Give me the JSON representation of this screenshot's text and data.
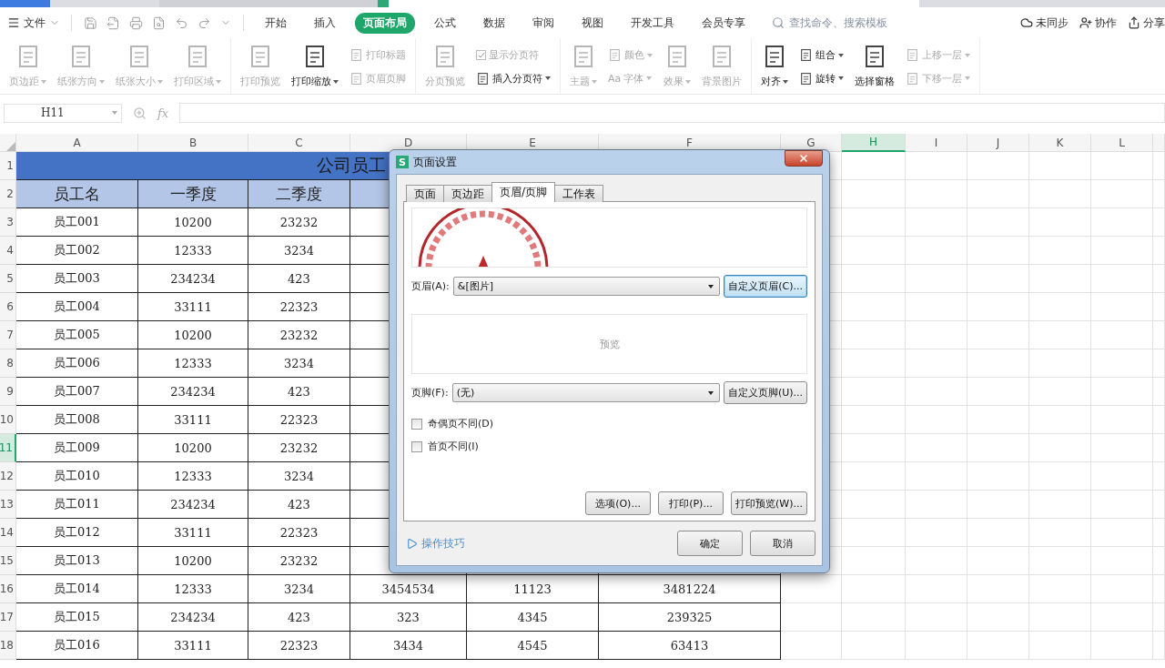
{
  "menu": {
    "file": "文件",
    "tabs": [
      {
        "label": "开始",
        "selected": false
      },
      {
        "label": "插入",
        "selected": false
      },
      {
        "label": "页面布局",
        "selected": true
      },
      {
        "label": "公式",
        "selected": false
      },
      {
        "label": "数据",
        "selected": false
      },
      {
        "label": "审阅",
        "selected": false
      },
      {
        "label": "视图",
        "selected": false
      },
      {
        "label": "开发工具",
        "selected": false
      },
      {
        "label": "会员专享",
        "selected": false
      }
    ],
    "search": {
      "placeholder": "查找命令、搜索模板"
    },
    "actions": [
      "未同步",
      "协作",
      "分享"
    ]
  },
  "ribbon": {
    "groups": [
      [
        {
          "kind": "large",
          "label": "页边距",
          "dropdown": true,
          "disabled": true
        },
        {
          "kind": "large",
          "label": "纸张方向",
          "dropdown": true,
          "disabled": true
        },
        {
          "kind": "large",
          "label": "纸张大小",
          "dropdown": true,
          "disabled": true
        },
        {
          "kind": "large",
          "label": "打印区域",
          "dropdown": true,
          "disabled": true
        }
      ],
      [
        {
          "kind": "large",
          "label": "打印预览",
          "dropdown": false,
          "disabled": true
        },
        {
          "kind": "large",
          "label": "打印缩放",
          "dropdown": true,
          "disabled": false
        },
        {
          "kind": "stack",
          "items": [
            {
              "kind": "small",
              "label": "打印标题",
              "dropdown": false,
              "disabled": true
            },
            {
              "kind": "small",
              "label": "页眉页脚",
              "dropdown": false,
              "disabled": true
            }
          ]
        }
      ],
      [
        {
          "kind": "large",
          "label": "分页预览",
          "dropdown": false,
          "disabled": true
        },
        {
          "kind": "stack",
          "items": [
            {
              "kind": "check",
              "label": "显示分页符",
              "checked": true,
              "disabled": true
            },
            {
              "kind": "small",
              "label": "插入分页符",
              "dropdown": true,
              "disabled": false
            }
          ]
        }
      ],
      [
        {
          "kind": "large",
          "label": "主题",
          "dropdown": true,
          "disabled": true
        },
        {
          "kind": "stack",
          "items": [
            {
              "kind": "small",
              "label": "颜色",
              "dropdown": true,
              "disabled": true
            },
            {
              "kind": "small",
              "label": "字体",
              "glyph": "Aa",
              "dropdown": true,
              "disabled": true
            }
          ]
        },
        {
          "kind": "large",
          "label": "效果",
          "dropdown": true,
          "disabled": true
        },
        {
          "kind": "large",
          "label": "背景图片",
          "dropdown": false,
          "disabled": true
        }
      ],
      [
        {
          "kind": "large",
          "label": "对齐",
          "dropdown": true,
          "disabled": false
        },
        {
          "kind": "stack",
          "items": [
            {
              "kind": "small",
              "label": "组合",
              "dropdown": true,
              "disabled": false
            },
            {
              "kind": "small",
              "label": "旋转",
              "dropdown": true,
              "disabled": false
            }
          ]
        },
        {
          "kind": "large",
          "label": "选择窗格",
          "dropdown": false,
          "disabled": false
        },
        {
          "kind": "stack",
          "items": [
            {
              "kind": "small",
              "label": "上移一层",
              "dropdown": true,
              "disabled": true
            },
            {
              "kind": "small",
              "label": "下移一层",
              "dropdown": true,
              "disabled": true
            }
          ]
        }
      ]
    ]
  },
  "formula_bar": {
    "cell": "H11",
    "fx": "fx"
  },
  "sheet": {
    "columns": [
      {
        "label": "A",
        "selected": false
      },
      {
        "label": "B",
        "selected": false
      },
      {
        "label": "C",
        "selected": false
      },
      {
        "label": "D",
        "selected": false
      },
      {
        "label": "E",
        "selected": false
      },
      {
        "label": "F",
        "selected": false
      },
      {
        "label": "G",
        "selected": false
      },
      {
        "label": "H",
        "selected": true
      },
      {
        "label": "I",
        "selected": false
      },
      {
        "label": "J",
        "selected": false
      },
      {
        "label": "K",
        "selected": false
      },
      {
        "label": "L",
        "selected": false
      }
    ],
    "rows": [
      {
        "num": "1",
        "kind": "title",
        "selected": false,
        "cells": [
          "公司员工"
        ]
      },
      {
        "num": "2",
        "kind": "header",
        "selected": false,
        "cells": [
          "员工名",
          "一季度",
          "二季度"
        ]
      },
      {
        "num": "3",
        "kind": "data",
        "selected": false,
        "cells": [
          "员工001",
          "10200",
          "23232"
        ]
      },
      {
        "num": "4",
        "kind": "data",
        "selected": false,
        "cells": [
          "员工002",
          "12333",
          "3234"
        ]
      },
      {
        "num": "5",
        "kind": "data",
        "selected": false,
        "cells": [
          "员工003",
          "234234",
          "423"
        ]
      },
      {
        "num": "6",
        "kind": "data",
        "selected": false,
        "cells": [
          "员工004",
          "33111",
          "22323"
        ]
      },
      {
        "num": "7",
        "kind": "data",
        "selected": false,
        "cells": [
          "员工005",
          "10200",
          "23232"
        ]
      },
      {
        "num": "8",
        "kind": "data",
        "selected": false,
        "cells": [
          "员工006",
          "12333",
          "3234"
        ]
      },
      {
        "num": "9",
        "kind": "data",
        "selected": false,
        "cells": [
          "员工007",
          "234234",
          "423"
        ]
      },
      {
        "num": "10",
        "kind": "data",
        "selected": false,
        "cells": [
          "员工008",
          "33111",
          "22323"
        ]
      },
      {
        "num": "11",
        "kind": "data",
        "selected": true,
        "cells": [
          "员工009",
          "10200",
          "23232"
        ]
      },
      {
        "num": "12",
        "kind": "data",
        "selected": false,
        "cells": [
          "员工010",
          "12333",
          "3234"
        ]
      },
      {
        "num": "13",
        "kind": "data",
        "selected": false,
        "cells": [
          "员工011",
          "234234",
          "423"
        ]
      },
      {
        "num": "14",
        "kind": "data",
        "selected": false,
        "cells": [
          "员工012",
          "33111",
          "22323"
        ]
      },
      {
        "num": "15",
        "kind": "data",
        "selected": false,
        "cells": [
          "员工013",
          "10200",
          "23232"
        ]
      },
      {
        "num": "16",
        "kind": "data",
        "selected": false,
        "cells": [
          "员工014",
          "12333",
          "3234",
          "3454534",
          "11123",
          "3481224"
        ]
      },
      {
        "num": "17",
        "kind": "data",
        "selected": false,
        "cells": [
          "员工015",
          "234234",
          "423",
          "323",
          "4345",
          "239325"
        ]
      },
      {
        "num": "18",
        "kind": "data",
        "selected": false,
        "cells": [
          "员工016",
          "33111",
          "22323",
          "3434",
          "4545",
          "63413"
        ]
      }
    ]
  },
  "dialog": {
    "app_badge": "S",
    "title": "页面设置",
    "tabs": [
      {
        "label": "页面",
        "selected": false
      },
      {
        "label": "页边距",
        "selected": false
      },
      {
        "label": "页眉/页脚",
        "selected": true
      },
      {
        "label": "工作表",
        "selected": false
      }
    ],
    "header": {
      "label": "页眉(A):",
      "value": "&[图片]",
      "button": "自定义页眉(C)...",
      "focused": true
    },
    "preview": "预览",
    "footer": {
      "label": "页脚(F):",
      "value": "(无)",
      "button": "自定义页脚(U)...",
      "focused": false
    },
    "options": [
      {
        "label": "奇偶页不同(D)",
        "checked": false
      },
      {
        "label": "首页不同(I)",
        "checked": false
      }
    ],
    "actions": [
      "选项(O)...",
      "打印(P)...",
      "打印预览(W)..."
    ],
    "tips": "操作技巧",
    "buttons": [
      "确定",
      "取消"
    ]
  }
}
